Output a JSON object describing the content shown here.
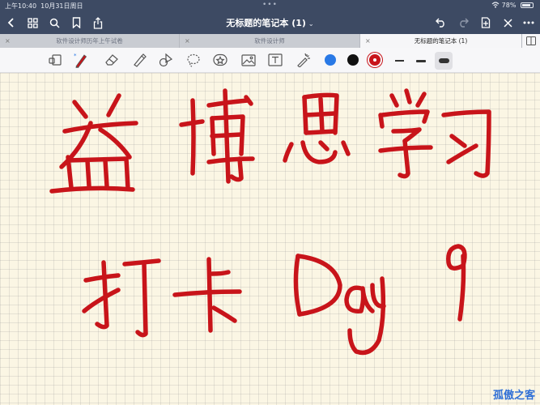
{
  "status_bar": {
    "time": "上午10:40",
    "date": "10月31日周日",
    "battery": "78%",
    "multitask_dots": "•••"
  },
  "title_bar": {
    "title": "无标题的笔记本 (1)",
    "caret": "⌄",
    "icons": [
      "back-icon",
      "grid-icon",
      "search-icon",
      "bookmark-icon",
      "share-icon",
      "undo-icon",
      "redo-icon",
      "new-page-icon",
      "close-icon",
      "more-icon"
    ]
  },
  "tabs": [
    {
      "label": "软件设计师历年上午试卷",
      "active": false
    },
    {
      "label": "软件设计师",
      "active": false
    },
    {
      "label": "无标题的笔记本 (1)",
      "active": true
    }
  ],
  "tab_close": "×",
  "toolbar": {
    "tools": [
      "reader-icon",
      "pen-icon",
      "eraser-icon",
      "highlighter-icon",
      "shapes-icon",
      "lasso-icon",
      "sticker-icon",
      "image-icon",
      "text-icon",
      "laser-icon"
    ],
    "colors": [
      "#2979e6",
      "#111111",
      "#c8141a"
    ],
    "ink_color": "#c8141a",
    "background_color": "#fbf6e4"
  },
  "watermark": "孤傲之客"
}
